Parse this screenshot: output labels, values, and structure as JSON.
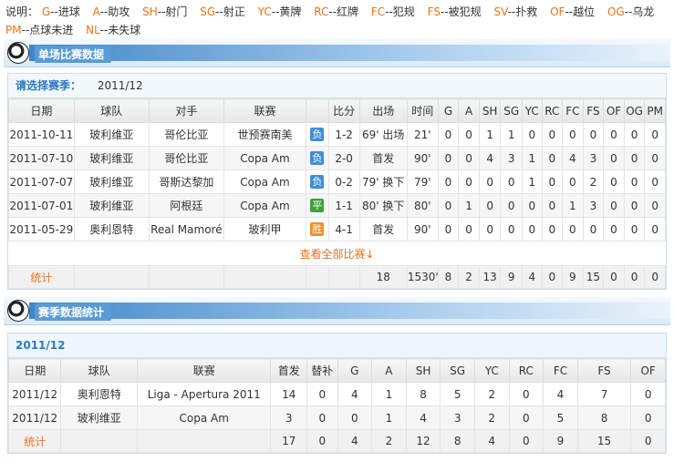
{
  "legend": {
    "prefix": "说明：",
    "items": [
      {
        "k": "G",
        "v": "--进球"
      },
      {
        "k": "A",
        "v": "--助攻"
      },
      {
        "k": "SH",
        "v": "--射门"
      },
      {
        "k": "SG",
        "v": "--射正"
      },
      {
        "k": "YC",
        "v": "--黄牌"
      },
      {
        "k": "RC",
        "v": "--红牌"
      },
      {
        "k": "FC",
        "v": "--犯规"
      },
      {
        "k": "FS",
        "v": "--被犯规"
      },
      {
        "k": "SV",
        "v": "--扑救"
      },
      {
        "k": "OF",
        "v": "--越位"
      },
      {
        "k": "OG",
        "v": "--乌龙"
      },
      {
        "k": "PM",
        "v": "--点球未进"
      },
      {
        "k": "NL",
        "v": "--未失球"
      }
    ]
  },
  "single": {
    "title": "单场比赛数据",
    "season_label": "请选择赛季：",
    "season_value": "2011/12",
    "headers": [
      "日期",
      "球队",
      "对手",
      "联赛",
      "",
      "比分",
      "出场",
      "时间",
      "G",
      "A",
      "SH",
      "SG",
      "YC",
      "RC",
      "FC",
      "FS",
      "OF",
      "OG",
      "PM"
    ],
    "rows": [
      [
        "2011-10-11",
        "玻利维亚",
        "哥伦比亚",
        "世预赛南美",
        "负",
        "1-2",
        "69' 出场",
        "21'",
        "0",
        "0",
        "1",
        "1",
        "0",
        "0",
        "0",
        "0",
        "0",
        "0",
        "0"
      ],
      [
        "2011-07-10",
        "玻利维亚",
        "哥伦比亚",
        "Copa Am",
        "负",
        "2-0",
        "首发",
        "90'",
        "0",
        "0",
        "4",
        "3",
        "1",
        "0",
        "4",
        "3",
        "0",
        "0",
        "0"
      ],
      [
        "2011-07-07",
        "玻利维亚",
        "哥斯达黎加",
        "Copa Am",
        "负",
        "0-2",
        "79' 换下",
        "79'",
        "0",
        "0",
        "0",
        "0",
        "1",
        "0",
        "0",
        "2",
        "0",
        "0",
        "0"
      ],
      [
        "2011-07-01",
        "玻利维亚",
        "阿根廷",
        "Copa Am",
        "平",
        "1-1",
        "80' 换下",
        "80'",
        "0",
        "1",
        "0",
        "0",
        "0",
        "0",
        "1",
        "3",
        "0",
        "0",
        "0"
      ],
      [
        "2011-05-29",
        "奥利恩特",
        "Real Mamoré",
        "玻利甲",
        "胜",
        "4-1",
        "首发",
        "90'",
        "0",
        "0",
        "0",
        "0",
        "0",
        "0",
        "0",
        "0",
        "0",
        "0",
        "0"
      ]
    ],
    "result_types": [
      "lose",
      "lose",
      "lose",
      "draw",
      "win"
    ],
    "more_label": "查看全部比赛↓",
    "total_label": "统计",
    "totals": [
      "18",
      "1530'",
      "8",
      "2",
      "13",
      "9",
      "4",
      "0",
      "9",
      "15",
      "0",
      "0",
      "0"
    ]
  },
  "season_stats": {
    "title": "赛季数据统计",
    "season": "2011/12",
    "headers": [
      "日期",
      "球队",
      "联赛",
      "首发",
      "替补",
      "G",
      "A",
      "SH",
      "SG",
      "YC",
      "RC",
      "FC",
      "FS",
      "OF"
    ],
    "rows": [
      [
        "2011/12",
        "奥利恩特",
        "Liga - Apertura 2011",
        "14",
        "0",
        "4",
        "1",
        "8",
        "5",
        "2",
        "0",
        "4",
        "7",
        "0"
      ],
      [
        "2011/12",
        "玻利维亚",
        "Copa Am",
        "3",
        "0",
        "0",
        "1",
        "4",
        "3",
        "2",
        "0",
        "5",
        "8",
        "0"
      ]
    ],
    "total_label": "统计",
    "totals": [
      "17",
      "0",
      "4",
      "2",
      "12",
      "8",
      "4",
      "0",
      "9",
      "15",
      "0"
    ]
  },
  "colors": {
    "accent": "#e8731c",
    "blue": "#2f78c4",
    "lose": "#3f8fd5",
    "draw": "#3aa33a",
    "win": "#f0902a"
  }
}
